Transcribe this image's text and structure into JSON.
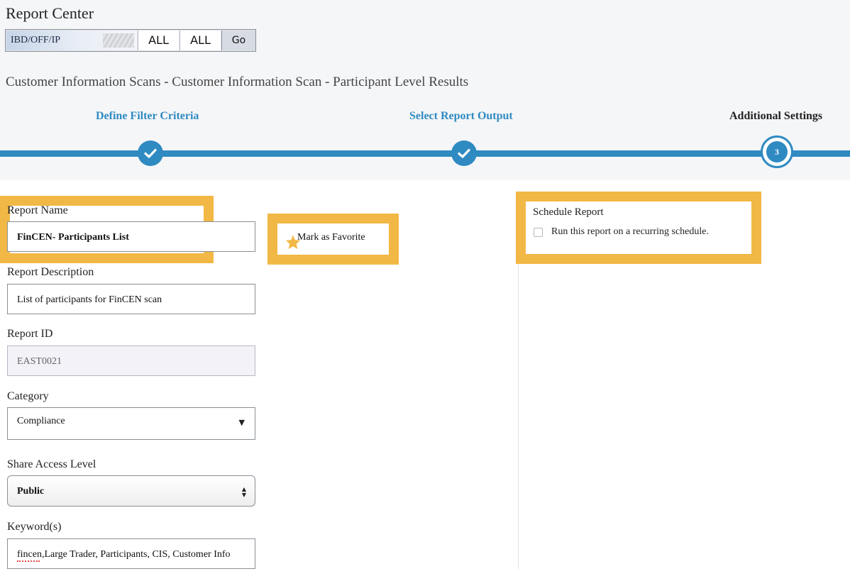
{
  "header": {
    "app_title": "Report Center",
    "selector": {
      "entity": "IBD/OFF/IP",
      "filter_1": "ALL",
      "filter_2": "ALL",
      "go_label": "Go"
    },
    "report_path": "Customer Information Scans - Customer Information Scan - Participant Level Results"
  },
  "stepper": {
    "steps": [
      {
        "label": "Define Filter Criteria",
        "status": "complete",
        "icon": "check-icon"
      },
      {
        "label": "Select Report Output",
        "status": "complete",
        "icon": "check-icon"
      },
      {
        "label": "Additional Settings",
        "status": "current",
        "number": "3"
      }
    ],
    "accent_color": "#2f8ac2"
  },
  "form": {
    "report_name": {
      "label": "Report Name",
      "value": "FinCEN- Participants List"
    },
    "report_description": {
      "label": "Report Description",
      "value": "List of participants for FinCEN scan"
    },
    "report_id": {
      "label": "Report ID",
      "value": "EAST0021"
    },
    "category": {
      "label": "Category",
      "value": "Compliance"
    },
    "share_access_level": {
      "label": "Share Access Level",
      "value": "Public"
    },
    "keywords": {
      "label": "Keyword(s)",
      "value": "fincen,Large Trader, Participants, CIS, Customer Info"
    }
  },
  "favorite": {
    "label": "Mark as Favorite",
    "icon": "star-icon"
  },
  "schedule": {
    "title": "Schedule Report",
    "checkbox_label": "Run this report on a recurring schedule.",
    "checked": false
  },
  "highlight_color": "#f2b845"
}
